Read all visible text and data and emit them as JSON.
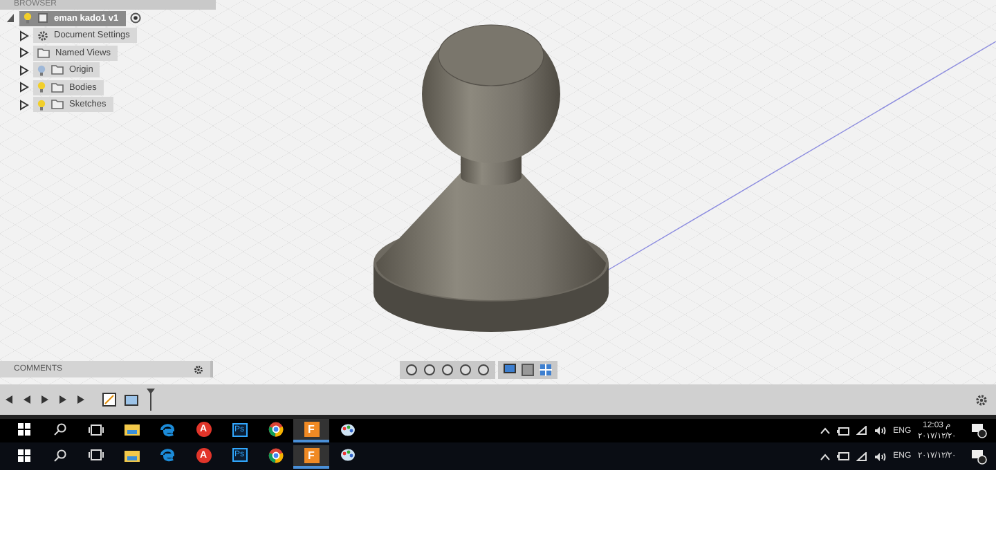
{
  "browser": {
    "title": "BROWSER",
    "root": {
      "label": "eman kado1 v1",
      "expanded": true,
      "visible": true,
      "selected": true,
      "children": [
        {
          "label": "Document Settings",
          "kind": "settings",
          "expanded": false,
          "selected": false
        },
        {
          "label": "Named Views",
          "kind": "folder",
          "expanded": false,
          "selected": false
        },
        {
          "label": "Origin",
          "kind": "folder",
          "expanded": false,
          "visible": false,
          "selected": false
        },
        {
          "label": "Bodies",
          "kind": "folder",
          "expanded": false,
          "visible": true,
          "selected": false
        },
        {
          "label": "Sketches",
          "kind": "folder",
          "expanded": false,
          "visible": true,
          "selected": false
        }
      ]
    }
  },
  "comments": {
    "title": "COMMENTS"
  },
  "taskbars": [
    {
      "apps": [
        {
          "kind": "start",
          "selected": false
        },
        {
          "kind": "search",
          "selected": false
        },
        {
          "kind": "taskview",
          "selected": false
        },
        {
          "kind": "explorer",
          "selected": false
        },
        {
          "kind": "edge",
          "selected": false
        },
        {
          "kind": "autodesk",
          "label": "A",
          "selected": false
        },
        {
          "kind": "photoshop",
          "label": "Ps",
          "selected": false
        },
        {
          "kind": "chrome",
          "selected": false
        },
        {
          "kind": "fusion",
          "label": "F",
          "selected": true
        },
        {
          "kind": "paint",
          "selected": false
        }
      ],
      "language": "ENG",
      "time": "12:03",
      "period": "م",
      "date": "۲۰۱۷/۱۲/۲۰"
    },
    {
      "apps": [
        {
          "kind": "start",
          "selected": false
        },
        {
          "kind": "search",
          "selected": false
        },
        {
          "kind": "taskview",
          "selected": false
        },
        {
          "kind": "explorer",
          "selected": false
        },
        {
          "kind": "edge",
          "selected": false
        },
        {
          "kind": "autodesk",
          "label": "A",
          "selected": false
        },
        {
          "kind": "photoshop",
          "label": "Ps",
          "selected": false
        },
        {
          "kind": "chrome",
          "selected": false
        },
        {
          "kind": "fusion",
          "label": "F",
          "selected": true
        },
        {
          "kind": "paint",
          "selected": false
        }
      ],
      "language": "ENG",
      "date": "۲۰۱۷/۱۲/۲۰"
    }
  ]
}
